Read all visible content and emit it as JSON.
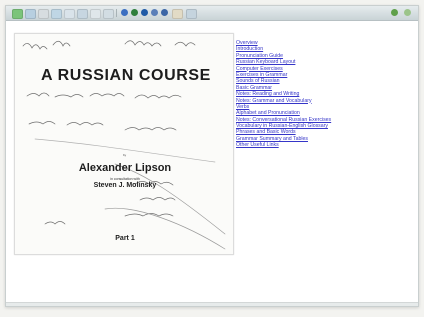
{
  "cover": {
    "title": "A RUSSIAN COURSE",
    "by": "by",
    "author": "Alexander Lipson",
    "assistance": "in consultation with",
    "assistant": "Steven J. Molinsky",
    "part": "Part 1"
  },
  "links": [
    {
      "label": "Overview"
    },
    {
      "label": "Introduction"
    },
    {
      "label": "Pronunciation Guide"
    },
    {
      "label": "Russian Keyboard Layout"
    },
    {
      "label": "Computer Exercises"
    },
    {
      "label": "Exercises in Grammar"
    },
    {
      "label": "Sounds of Russian"
    },
    {
      "label": "Basic Grammar"
    },
    {
      "label": "Notes: Reading and Writing"
    },
    {
      "label": "Notes: Grammar and Vocabulary"
    },
    {
      "label": "Verbs"
    },
    {
      "label": "Alphabet and Pronunciation"
    },
    {
      "label": "Notes: Conversational Russian Exercises"
    },
    {
      "label": "Vocabulary in Russian-English Glossary"
    },
    {
      "label": "Phrases and Basic Words"
    },
    {
      "label": "Grammar Summary and Tables"
    },
    {
      "label": "Other Useful Links"
    }
  ],
  "colors": {
    "link": "#3535c8",
    "toolbar": "#c9d3d6"
  }
}
